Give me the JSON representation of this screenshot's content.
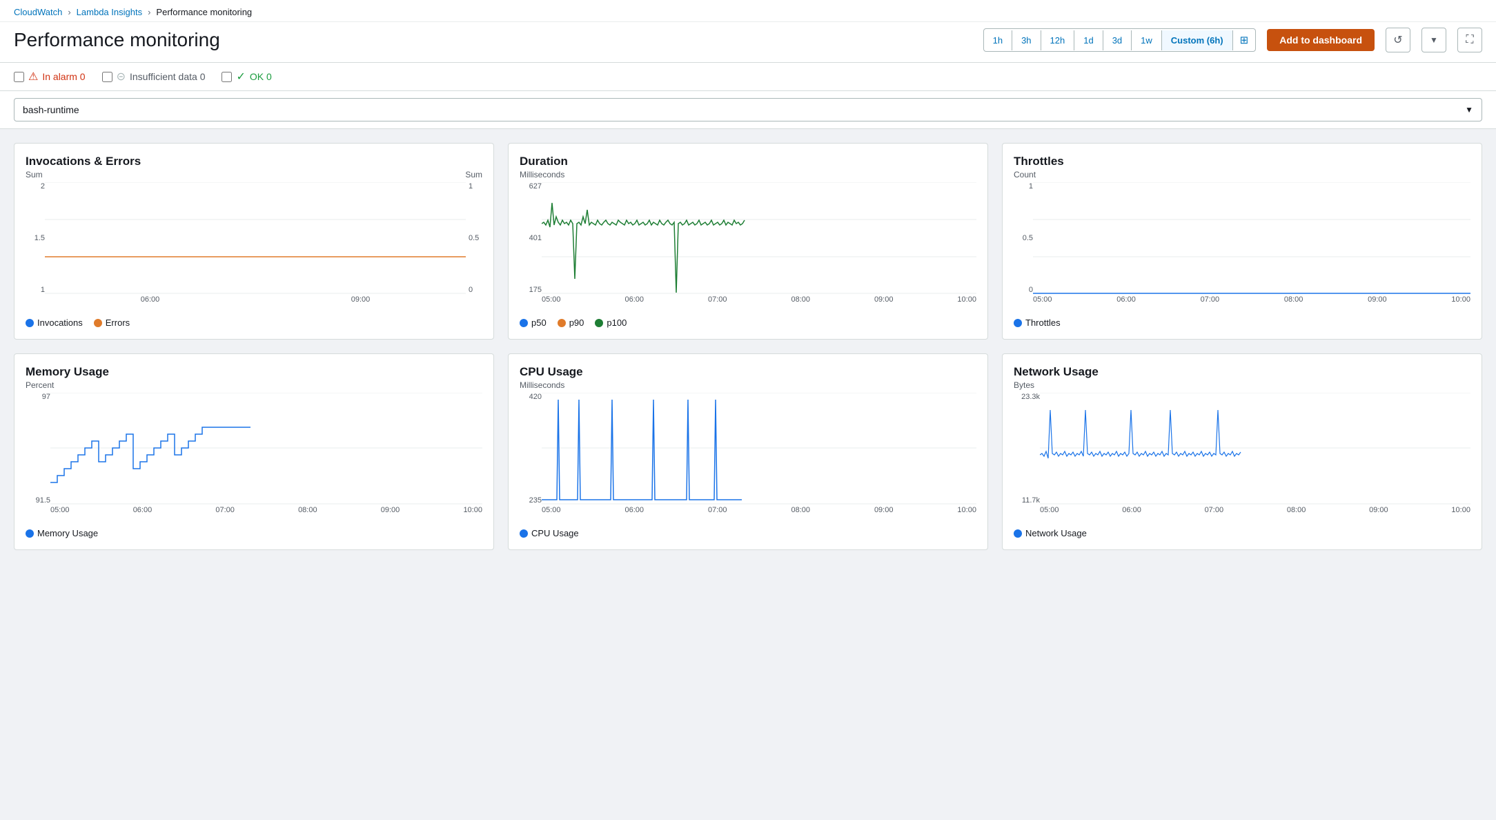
{
  "breadcrumb": {
    "cloudwatch": "CloudWatch",
    "lambda_insights": "Lambda Insights",
    "current": "Performance monitoring"
  },
  "header": {
    "title": "Performance monitoring",
    "time_options": [
      "1h",
      "3h",
      "12h",
      "1d",
      "3d",
      "1w"
    ],
    "active_time": "Custom (6h)",
    "add_dashboard_label": "Add to dashboard"
  },
  "alarm_filters": {
    "in_alarm": {
      "label": "In alarm 0",
      "count": 0
    },
    "insufficient": {
      "label": "Insufficient data 0",
      "count": 0
    },
    "ok": {
      "label": "OK 0",
      "count": 0
    }
  },
  "function_selector": {
    "value": "bash-runtime",
    "placeholder": "bash-runtime"
  },
  "charts": {
    "invocations": {
      "title": "Invocations & Errors",
      "y_label": "Sum",
      "y2_label": "Sum",
      "unit": "",
      "y_values": [
        "2",
        "1.5",
        "1"
      ],
      "y2_values": [
        "1",
        "0.5",
        "0"
      ],
      "x_labels": [
        "06:00",
        "09:00"
      ],
      "legend": [
        {
          "label": "Invocations",
          "color": "#1a73e8"
        },
        {
          "label": "Errors",
          "color": "#e07b2a"
        }
      ]
    },
    "duration": {
      "title": "Duration",
      "unit": "Milliseconds",
      "y_values": [
        "627",
        "401",
        "175"
      ],
      "x_labels": [
        "05:00",
        "06:00",
        "07:00",
        "08:00",
        "09:00",
        "10:00"
      ],
      "legend": [
        {
          "label": "p50",
          "color": "#1a73e8"
        },
        {
          "label": "p90",
          "color": "#e07b2a"
        },
        {
          "label": "p100",
          "color": "#1e7e34"
        }
      ]
    },
    "throttles": {
      "title": "Throttles",
      "unit": "Count",
      "y_values": [
        "1",
        "0.5",
        "0"
      ],
      "x_labels": [
        "05:00",
        "06:00",
        "07:00",
        "08:00",
        "09:00",
        "10:00"
      ],
      "legend": [
        {
          "label": "Throttles",
          "color": "#1a73e8"
        }
      ]
    },
    "memory": {
      "title": "Memory Usage",
      "unit": "Percent",
      "y_values": [
        "97",
        "91.5"
      ],
      "x_labels": [
        "05:00",
        "06:00",
        "07:00",
        "08:00",
        "09:00",
        "10:00"
      ],
      "legend": [
        {
          "label": "Memory Usage",
          "color": "#1a73e8"
        }
      ]
    },
    "cpu": {
      "title": "CPU Usage",
      "unit": "Milliseconds",
      "y_values": [
        "420",
        "235"
      ],
      "x_labels": [
        "05:00",
        "06:00",
        "07:00",
        "08:00",
        "09:00",
        "10:00"
      ],
      "legend": [
        {
          "label": "CPU Usage",
          "color": "#1a73e8"
        }
      ]
    },
    "network": {
      "title": "Network Usage",
      "unit": "Bytes",
      "y_values": [
        "23.3k",
        "11.7k"
      ],
      "x_labels": [
        "05:00",
        "06:00",
        "07:00",
        "08:00",
        "09:00",
        "10:00"
      ],
      "legend": [
        {
          "label": "Network Usage",
          "color": "#1a73e8"
        }
      ]
    }
  },
  "icons": {
    "chevron_right": "›",
    "chevron_down": "▼",
    "refresh": "↺",
    "fullscreen": "⛶",
    "grid": "⊞"
  }
}
